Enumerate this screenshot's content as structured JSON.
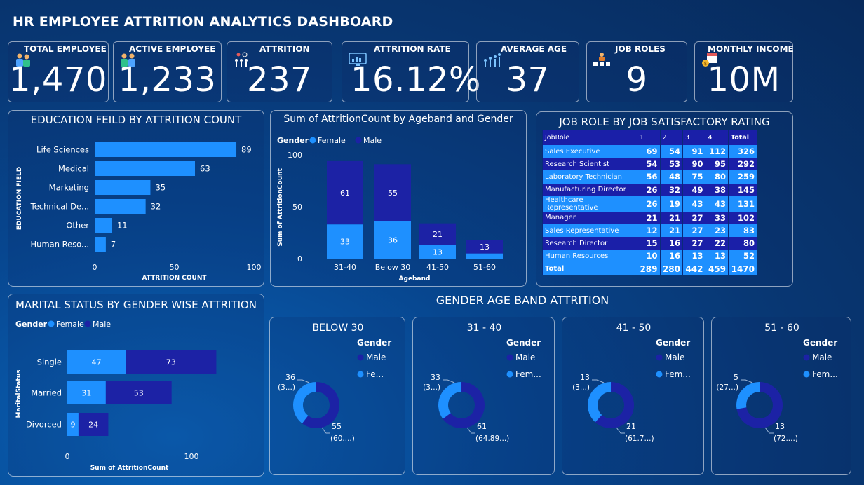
{
  "dashboard_title": "HR EMPLOYEE ATTRITION ANALYTICS DASHBOARD",
  "kpis": [
    {
      "label": "TOTAL EMPLOYEE",
      "value": "1,470",
      "icon": "people-icon"
    },
    {
      "label": "ACTIVE EMPLOYEE",
      "value": "1,233",
      "icon": "team-icon"
    },
    {
      "label": "ATTRITION",
      "value": "237",
      "icon": "attrition-people-icon"
    },
    {
      "label": "ATTRITION RATE",
      "value": "16.12%",
      "icon": "monitor-chart-icon"
    },
    {
      "label": "AVERAGE AGE",
      "value": "37",
      "icon": "age-group-icon"
    },
    {
      "label": "JOB ROLES",
      "value": "9",
      "icon": "job-roles-icon"
    },
    {
      "label": "MONTHLY INCOME",
      "value": "10M",
      "icon": "income-calendar-icon"
    }
  ],
  "colors": {
    "female": "#1e90ff",
    "male": "#1c22a5",
    "table_row_a": "#1e90ff",
    "table_row_b": "#1a1fa8"
  },
  "chart_data": [
    {
      "type": "bar",
      "title": "EDUCATION FEILD BY ATTRITION COUNT",
      "orientation": "horizontal",
      "categories": [
        "Life Sciences",
        "Medical",
        "Marketing",
        "Technical De...",
        "Other",
        "Human Reso..."
      ],
      "values": [
        89,
        63,
        35,
        32,
        11,
        7
      ],
      "xlabel": "ATTRITION COUNT",
      "ylabel": "EDUCATION FIELD",
      "xlim": [
        0,
        100
      ],
      "xticks": [
        "0",
        "50",
        "100"
      ]
    },
    {
      "type": "bar",
      "stacked": true,
      "title": "Sum of AttritionCount by Ageband and Gender",
      "legend_title": "Gender",
      "legend": [
        "Female",
        "Male"
      ],
      "categories": [
        "31-40",
        "Below 30",
        "41-50",
        "51-60"
      ],
      "series": [
        {
          "name": "Female",
          "values": [
            33,
            36,
            13,
            5
          ]
        },
        {
          "name": "Male",
          "values": [
            61,
            55,
            21,
            13
          ]
        }
      ],
      "data_labels": [
        [
          "33",
          "61"
        ],
        [
          "36",
          "55"
        ],
        [
          "13",
          "21"
        ],
        [
          "",
          "13"
        ]
      ],
      "xlabel": "Ageband",
      "ylabel": "Sum of AttritionCount",
      "ylim": [
        0,
        100
      ],
      "yticks": [
        "0",
        "50",
        "100"
      ]
    },
    {
      "type": "table",
      "title": "JOB ROLE BY JOB SATISFACTORY RATING",
      "columns": [
        "JobRole",
        "1",
        "2",
        "3",
        "4",
        "Total"
      ],
      "rows": [
        [
          "Sales Executive",
          "69",
          "54",
          "91",
          "112",
          "326"
        ],
        [
          "Research Scientist",
          "54",
          "53",
          "90",
          "95",
          "292"
        ],
        [
          "Laboratory Technician",
          "56",
          "48",
          "75",
          "80",
          "259"
        ],
        [
          "Manufacturing Director",
          "26",
          "32",
          "49",
          "38",
          "145"
        ],
        [
          "Healthcare Representative",
          "26",
          "19",
          "43",
          "43",
          "131"
        ],
        [
          "Manager",
          "21",
          "21",
          "27",
          "33",
          "102"
        ],
        [
          "Sales Representative",
          "12",
          "21",
          "27",
          "23",
          "83"
        ],
        [
          "Research Director",
          "15",
          "16",
          "27",
          "22",
          "80"
        ],
        [
          "Human Resources",
          "10",
          "16",
          "13",
          "13",
          "52"
        ]
      ],
      "total_row": [
        "Total",
        "289",
        "280",
        "442",
        "459",
        "1470"
      ]
    },
    {
      "type": "bar",
      "stacked": true,
      "orientation": "horizontal",
      "title": "MARITAL STATUS BY GENDER WISE ATTRITION",
      "legend_title": "Gender",
      "legend": [
        "Female",
        "Male"
      ],
      "categories": [
        "Single",
        "Married",
        "Divorced"
      ],
      "series": [
        {
          "name": "Female",
          "values": [
            47,
            31,
            9
          ]
        },
        {
          "name": "Male",
          "values": [
            73,
            53,
            24
          ]
        }
      ],
      "xlabel": "Sum of AttritionCount",
      "ylabel": "MaritalStatus",
      "xlim": [
        0,
        100
      ],
      "xticks": [
        "0",
        "100"
      ]
    },
    {
      "type": "pie",
      "donut": true,
      "group_title": "GENDER AGE BAND ATTRITION",
      "title": "BELOW 30",
      "legend_title": "Gender",
      "legend": [
        "Male",
        "Fe..."
      ],
      "values": {
        "Male": 55,
        "Female": 36
      },
      "labels": {
        "female_count": "36",
        "female_pct": "(3...)",
        "male_count": "55",
        "male_pct": "(60....)"
      }
    },
    {
      "type": "pie",
      "donut": true,
      "title": "31 - 40",
      "legend_title": "Gender",
      "legend": [
        "Male",
        "Fem..."
      ],
      "values": {
        "Male": 61,
        "Female": 33
      },
      "labels": {
        "female_count": "33",
        "female_pct": "(3...)",
        "male_count": "61",
        "male_pct": "(64.89...)"
      }
    },
    {
      "type": "pie",
      "donut": true,
      "title": "41 - 50",
      "legend_title": "Gender",
      "legend": [
        "Male",
        "Fem..."
      ],
      "values": {
        "Male": 21,
        "Female": 13
      },
      "labels": {
        "female_count": "13",
        "female_pct": "(3...)",
        "male_count": "21",
        "male_pct": "(61.7...)"
      }
    },
    {
      "type": "pie",
      "donut": true,
      "title": "51 - 60",
      "legend_title": "Gender",
      "legend": [
        "Male",
        "Fem..."
      ],
      "values": {
        "Male": 13,
        "Female": 5
      },
      "labels": {
        "female_count": "5",
        "female_pct": "(27...)",
        "male_count": "13",
        "male_pct": "(72....)"
      }
    }
  ]
}
